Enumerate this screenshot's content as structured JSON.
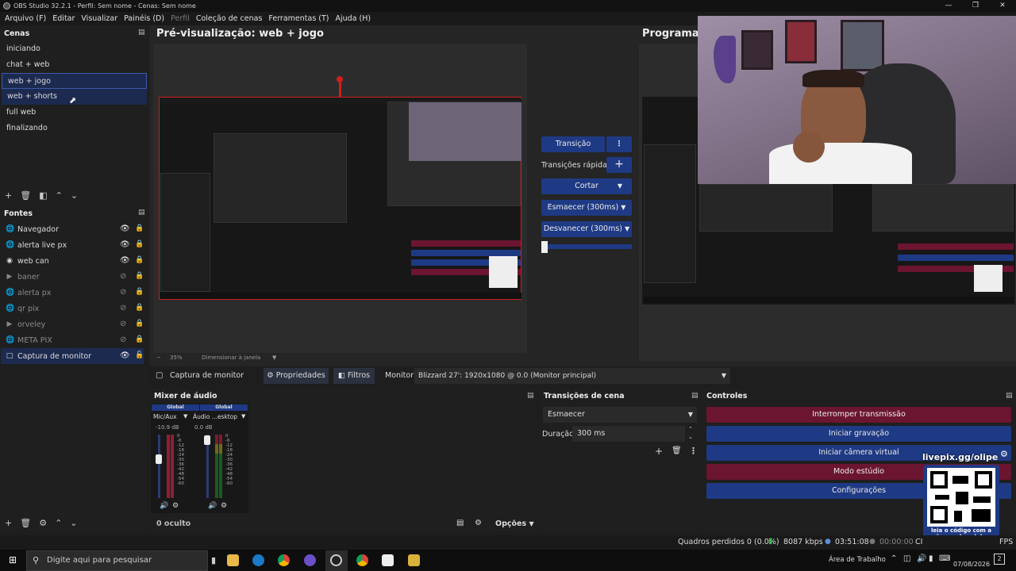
{
  "window": {
    "title": "OBS Studio 32.2.1 - Perfil: Sem nome - Cenas: Sem nome"
  },
  "menu": [
    "Arquivo (F)",
    "Editar",
    "Visualizar",
    "Painéis (D)",
    "Perfil",
    "Coleção de cenas",
    "Ferramentas (T)",
    "Ajuda (H)"
  ],
  "scenes": {
    "title": "Cenas",
    "items": [
      "iniciando",
      "chat + web",
      "web + jogo",
      "web + shorts",
      "full web",
      "finalizando"
    ]
  },
  "sources": {
    "title": "Fontes",
    "items": [
      {
        "label": "Navegador",
        "icon": "globe-icon",
        "visible": true
      },
      {
        "label": "alerta live px",
        "icon": "globe-icon",
        "visible": true
      },
      {
        "label": "web can",
        "icon": "camera-icon",
        "visible": true
      },
      {
        "label": "baner",
        "icon": "play-icon",
        "visible": false
      },
      {
        "label": "alerta px",
        "icon": "globe-icon",
        "visible": false
      },
      {
        "label": "qr pix",
        "icon": "globe-icon",
        "visible": false
      },
      {
        "label": "orveley",
        "icon": "play-icon",
        "visible": false
      },
      {
        "label": "META PIX",
        "icon": "globe-icon",
        "visible": false
      },
      {
        "label": "Captura de monitor",
        "icon": "monitor-icon",
        "visible": true
      }
    ]
  },
  "preview": {
    "title": "Pré-visualização: web + jogo",
    "zoom": "35%",
    "scale_label": "Dimensionar à janela"
  },
  "program": {
    "title": "Programa:"
  },
  "transition_panel": {
    "transition": "Transição",
    "quick": "Transições rápidas",
    "cut": "Cortar",
    "fade": "Esmaecer (300ms)",
    "fade2": "Desvanecer (300ms)"
  },
  "source_toolbar": {
    "source_name": "Captura de monitor",
    "properties": "Propriedades",
    "filters": "Filtros",
    "monitor_label": "Monitor",
    "monitor_value": "Blizzard 27': 1920x1080 @ 0.0 (Monitor principal)"
  },
  "mixer": {
    "title": "Mixer de áudio",
    "channels": [
      {
        "tag": "Global",
        "name": "Mic/Aux",
        "db": "-10.9 dB",
        "level": 0.35
      },
      {
        "tag": "Global",
        "name": "Áudio ...esktop",
        "db": "0.0 dB",
        "level": 0.85
      }
    ],
    "scale": [
      "0",
      "-6",
      "-12",
      "-18",
      "-24",
      "-30",
      "-36",
      "-42",
      "-48",
      "-54",
      "-60"
    ],
    "hidden": "0 oculto",
    "options": "Opções"
  },
  "scene_transitions": {
    "title": "Transições de cena",
    "value": "Esmaecer",
    "duration_label": "Duração",
    "duration_value": "300 ms"
  },
  "controls": {
    "title": "Controles",
    "buttons": [
      "Interromper transmissão",
      "Iniciar gravação",
      "Iniciar câmera virtual",
      "Modo estúdio",
      "Configurações"
    ]
  },
  "overlay": {
    "qr_title": "livepix.gg/olipe",
    "qr_caption": "leia o código com a câmera do celular."
  },
  "status": {
    "frames": "Quadros perdidos 0 (0.0%)",
    "bitrate": "8087 kbps",
    "live_time": "03:51:08",
    "rec_time": "00:00:00",
    "cpu": "CI",
    "fps": "FPS"
  },
  "taskbar": {
    "search_placeholder": "Digite aqui para pesquisar",
    "tray_label": "Área de Trabalho",
    "date": "07/08/2026",
    "notif": "2"
  },
  "colors": {
    "accent": "#1f3a84",
    "danger": "#6b1530",
    "selection": "#d21d1d"
  }
}
